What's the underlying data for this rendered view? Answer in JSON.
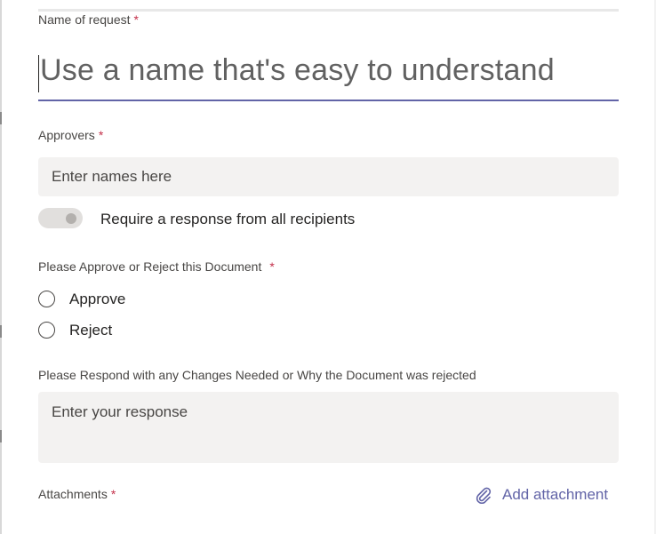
{
  "form": {
    "name": {
      "label": "Name of request",
      "required_marker": "*",
      "placeholder": "Use a name that's easy to understand"
    },
    "approvers": {
      "label": "Approvers",
      "required_marker": "*",
      "placeholder": "Enter names here"
    },
    "require_all": {
      "label": "Require a response from all recipients",
      "state": "off"
    },
    "decision": {
      "label": "Please Approve or Reject this Document",
      "required_marker": "*",
      "options": [
        {
          "label": "Approve",
          "selected": false
        },
        {
          "label": "Reject",
          "selected": false
        }
      ]
    },
    "response": {
      "label": "Please Respond with any Changes Needed or Why the Document was rejected",
      "placeholder": "Enter your response"
    },
    "attachments": {
      "label": "Attachments",
      "required_marker": "*",
      "add_label": "Add attachment",
      "icon": "paperclip-icon"
    }
  },
  "colors": {
    "accent": "#6264a7",
    "required": "#c4314b",
    "field_bg": "#f3f2f1"
  }
}
